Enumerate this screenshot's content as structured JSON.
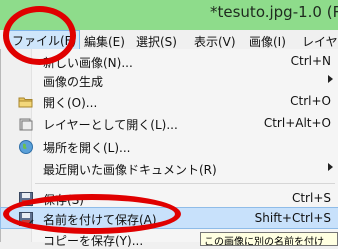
{
  "window": {
    "title": "*tesuto.jpg-1.0 (R"
  },
  "menubar": {
    "items": [
      {
        "label": "ファイル(F)"
      },
      {
        "label": "編集(E)"
      },
      {
        "label": "選択(S)"
      },
      {
        "label": "表示(V)"
      },
      {
        "label": "画像(I)"
      },
      {
        "label": "レイヤー"
      }
    ]
  },
  "file_menu": {
    "items": [
      {
        "label": "新しい画像(N)...",
        "shortcut": "Ctrl+N",
        "icon": "new-image-icon"
      },
      {
        "label": "画像の生成",
        "icon": "none",
        "submenu": true
      },
      {
        "label": "開く(O)...",
        "shortcut": "Ctrl+O",
        "icon": "folder-icon"
      },
      {
        "label": "レイヤーとして開く(L)...",
        "shortcut": "Ctrl+Alt+O",
        "icon": "open-as-layers-icon"
      },
      {
        "label": "場所を開く(L)...",
        "icon": "globe-icon"
      },
      {
        "label": "最近開いた画像ドキュメント(R)",
        "icon": "none",
        "submenu": true
      },
      {
        "label": "保存(S)",
        "shortcut": "Ctrl+S",
        "icon": "save-icon"
      },
      {
        "label": "名前を付けて保存(A)...",
        "shortcut": "Shift+Ctrl+S",
        "icon": "save-as-icon",
        "highlighted": true
      },
      {
        "label": "コピーを保存(Y)..."
      }
    ]
  },
  "tooltip": {
    "text": "この画像に別の名前を付け"
  },
  "colors": {
    "titlebar": "#8edc8b",
    "highlight": "#c8e1fb",
    "annotation": "#e00000"
  }
}
